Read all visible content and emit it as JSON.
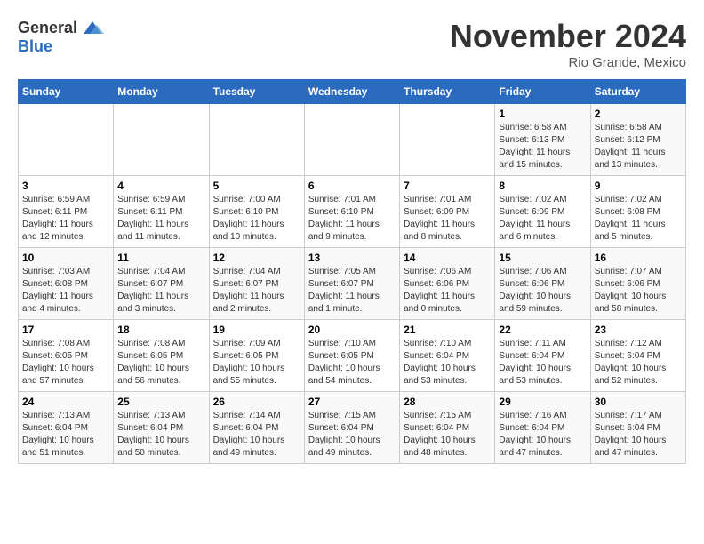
{
  "header": {
    "logo": {
      "text_general": "General",
      "text_blue": "Blue"
    },
    "title": "November 2024",
    "location": "Rio Grande, Mexico"
  },
  "weekdays": [
    "Sunday",
    "Monday",
    "Tuesday",
    "Wednesday",
    "Thursday",
    "Friday",
    "Saturday"
  ],
  "weeks": [
    [
      {
        "day": "",
        "info": ""
      },
      {
        "day": "",
        "info": ""
      },
      {
        "day": "",
        "info": ""
      },
      {
        "day": "",
        "info": ""
      },
      {
        "day": "",
        "info": ""
      },
      {
        "day": "1",
        "info": "Sunrise: 6:58 AM\nSunset: 6:13 PM\nDaylight: 11 hours and 15 minutes."
      },
      {
        "day": "2",
        "info": "Sunrise: 6:58 AM\nSunset: 6:12 PM\nDaylight: 11 hours and 13 minutes."
      }
    ],
    [
      {
        "day": "3",
        "info": "Sunrise: 6:59 AM\nSunset: 6:11 PM\nDaylight: 11 hours and 12 minutes."
      },
      {
        "day": "4",
        "info": "Sunrise: 6:59 AM\nSunset: 6:11 PM\nDaylight: 11 hours and 11 minutes."
      },
      {
        "day": "5",
        "info": "Sunrise: 7:00 AM\nSunset: 6:10 PM\nDaylight: 11 hours and 10 minutes."
      },
      {
        "day": "6",
        "info": "Sunrise: 7:01 AM\nSunset: 6:10 PM\nDaylight: 11 hours and 9 minutes."
      },
      {
        "day": "7",
        "info": "Sunrise: 7:01 AM\nSunset: 6:09 PM\nDaylight: 11 hours and 8 minutes."
      },
      {
        "day": "8",
        "info": "Sunrise: 7:02 AM\nSunset: 6:09 PM\nDaylight: 11 hours and 6 minutes."
      },
      {
        "day": "9",
        "info": "Sunrise: 7:02 AM\nSunset: 6:08 PM\nDaylight: 11 hours and 5 minutes."
      }
    ],
    [
      {
        "day": "10",
        "info": "Sunrise: 7:03 AM\nSunset: 6:08 PM\nDaylight: 11 hours and 4 minutes."
      },
      {
        "day": "11",
        "info": "Sunrise: 7:04 AM\nSunset: 6:07 PM\nDaylight: 11 hours and 3 minutes."
      },
      {
        "day": "12",
        "info": "Sunrise: 7:04 AM\nSunset: 6:07 PM\nDaylight: 11 hours and 2 minutes."
      },
      {
        "day": "13",
        "info": "Sunrise: 7:05 AM\nSunset: 6:07 PM\nDaylight: 11 hours and 1 minute."
      },
      {
        "day": "14",
        "info": "Sunrise: 7:06 AM\nSunset: 6:06 PM\nDaylight: 11 hours and 0 minutes."
      },
      {
        "day": "15",
        "info": "Sunrise: 7:06 AM\nSunset: 6:06 PM\nDaylight: 10 hours and 59 minutes."
      },
      {
        "day": "16",
        "info": "Sunrise: 7:07 AM\nSunset: 6:06 PM\nDaylight: 10 hours and 58 minutes."
      }
    ],
    [
      {
        "day": "17",
        "info": "Sunrise: 7:08 AM\nSunset: 6:05 PM\nDaylight: 10 hours and 57 minutes."
      },
      {
        "day": "18",
        "info": "Sunrise: 7:08 AM\nSunset: 6:05 PM\nDaylight: 10 hours and 56 minutes."
      },
      {
        "day": "19",
        "info": "Sunrise: 7:09 AM\nSunset: 6:05 PM\nDaylight: 10 hours and 55 minutes."
      },
      {
        "day": "20",
        "info": "Sunrise: 7:10 AM\nSunset: 6:05 PM\nDaylight: 10 hours and 54 minutes."
      },
      {
        "day": "21",
        "info": "Sunrise: 7:10 AM\nSunset: 6:04 PM\nDaylight: 10 hours and 53 minutes."
      },
      {
        "day": "22",
        "info": "Sunrise: 7:11 AM\nSunset: 6:04 PM\nDaylight: 10 hours and 53 minutes."
      },
      {
        "day": "23",
        "info": "Sunrise: 7:12 AM\nSunset: 6:04 PM\nDaylight: 10 hours and 52 minutes."
      }
    ],
    [
      {
        "day": "24",
        "info": "Sunrise: 7:13 AM\nSunset: 6:04 PM\nDaylight: 10 hours and 51 minutes."
      },
      {
        "day": "25",
        "info": "Sunrise: 7:13 AM\nSunset: 6:04 PM\nDaylight: 10 hours and 50 minutes."
      },
      {
        "day": "26",
        "info": "Sunrise: 7:14 AM\nSunset: 6:04 PM\nDaylight: 10 hours and 49 minutes."
      },
      {
        "day": "27",
        "info": "Sunrise: 7:15 AM\nSunset: 6:04 PM\nDaylight: 10 hours and 49 minutes."
      },
      {
        "day": "28",
        "info": "Sunrise: 7:15 AM\nSunset: 6:04 PM\nDaylight: 10 hours and 48 minutes."
      },
      {
        "day": "29",
        "info": "Sunrise: 7:16 AM\nSunset: 6:04 PM\nDaylight: 10 hours and 47 minutes."
      },
      {
        "day": "30",
        "info": "Sunrise: 7:17 AM\nSunset: 6:04 PM\nDaylight: 10 hours and 47 minutes."
      }
    ]
  ]
}
